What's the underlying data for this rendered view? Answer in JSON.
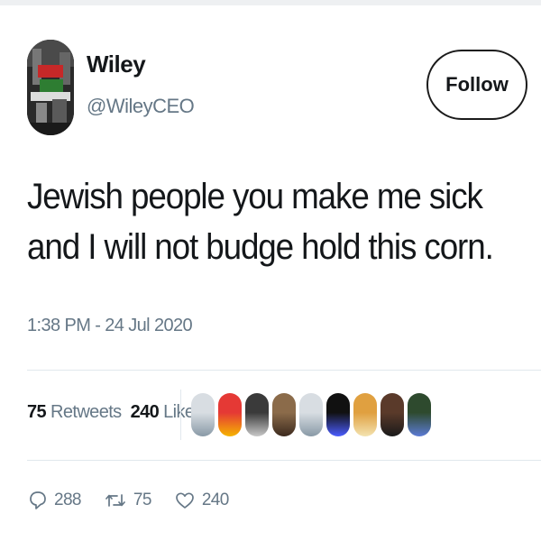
{
  "user": {
    "name": "Wiley",
    "handle": "@WileyCEO",
    "follow_label": "Follow"
  },
  "tweet": {
    "text": "Jewish people you make me sick and I will not budge hold this corn.",
    "timestamp": "1:38 PM - 24 Jul 2020"
  },
  "stats": {
    "retweets_count": "75",
    "retweets_label": "Retweets",
    "likes_count": "240",
    "likes_label": "Likes"
  },
  "likers": [
    {
      "name": "liker-1",
      "colors": [
        "#d8dde2",
        "#8899a6"
      ]
    },
    {
      "name": "liker-2",
      "colors": [
        "#e53935",
        "#f5b400"
      ]
    },
    {
      "name": "liker-3",
      "colors": [
        "#3a3a3a",
        "#c8c8c8"
      ]
    },
    {
      "name": "liker-4",
      "colors": [
        "#8b6b4a",
        "#3c2a1e"
      ]
    },
    {
      "name": "liker-5",
      "colors": [
        "#d8dde2",
        "#8899a6"
      ]
    },
    {
      "name": "liker-6",
      "colors": [
        "#111111",
        "#4a5cff"
      ]
    },
    {
      "name": "liker-7",
      "colors": [
        "#e0a040",
        "#f3e3b0"
      ]
    },
    {
      "name": "liker-8",
      "colors": [
        "#5a3a2a",
        "#1a1a1a"
      ]
    },
    {
      "name": "liker-9",
      "colors": [
        "#2e4a2e",
        "#5b7bd5"
      ]
    }
  ],
  "actions": {
    "replies": "288",
    "retweets": "75",
    "likes": "240"
  },
  "icons": {
    "reply": "reply-icon",
    "retweet": "retweet-icon",
    "like": "heart-icon"
  },
  "colors": {
    "text": "#14171a",
    "secondary": "#657786",
    "divider": "#e1e8ed"
  }
}
